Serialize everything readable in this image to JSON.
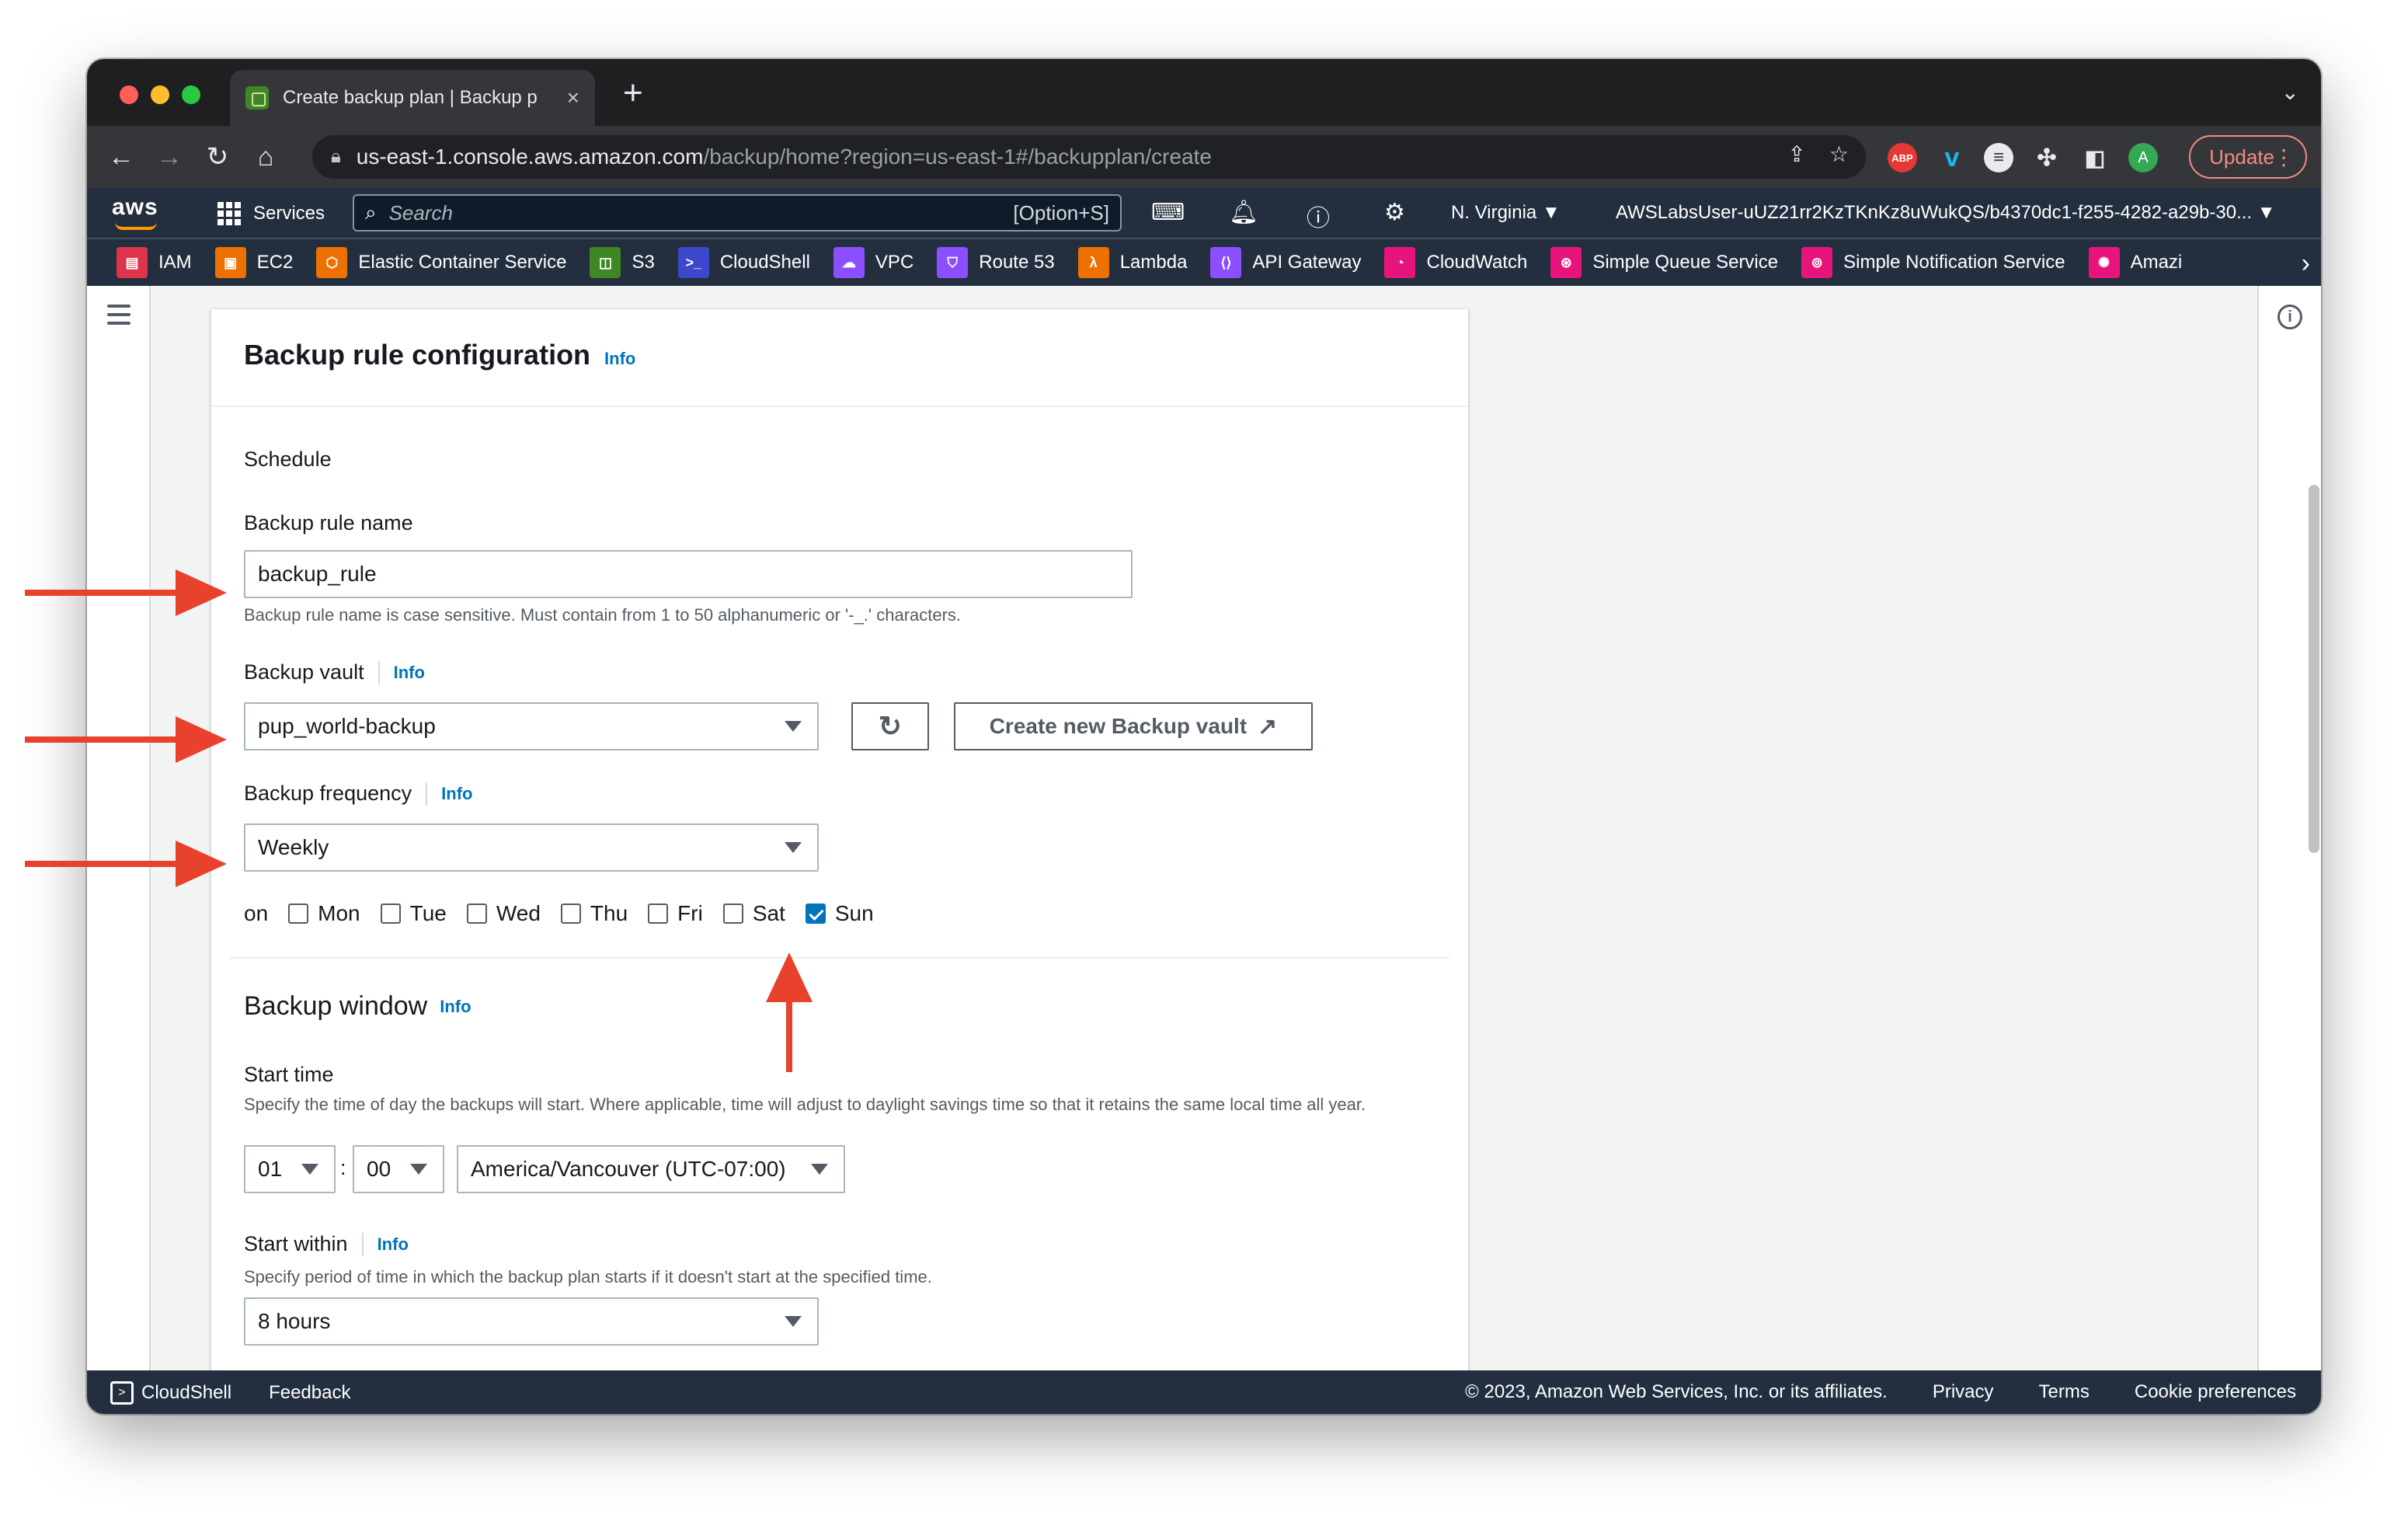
{
  "browser": {
    "tab_title": "Create backup plan | Backup p",
    "tab_close": "×",
    "new_tab": "+",
    "url_host": "us-east-1.console.aws.amazon.com",
    "url_path": "/backup/home?region=us-east-1#/backupplan/create",
    "update_label": "Update",
    "profile_initial": "A"
  },
  "awsnav": {
    "logo": "aws",
    "services_label": "Services",
    "search_placeholder": "Search",
    "search_shortcut": "[Option+S]",
    "region": "N. Virginia ▼",
    "account": "AWSLabsUser-uUZ21rr2KzTKnKz8uWukQS/b4370dc1-f255-4282-a29b-30... ▼"
  },
  "favorites": [
    {
      "label": "IAM",
      "color": "#dd344c"
    },
    {
      "label": "EC2",
      "color": "#ed7100"
    },
    {
      "label": "Elastic Container Service",
      "color": "#ed7100"
    },
    {
      "label": "S3",
      "color": "#3f8624"
    },
    {
      "label": "CloudShell",
      "color": "#3b48cc"
    },
    {
      "label": "VPC",
      "color": "#8c4fff"
    },
    {
      "label": "Route 53",
      "color": "#8c4fff"
    },
    {
      "label": "Lambda",
      "color": "#ed7100"
    },
    {
      "label": "API Gateway",
      "color": "#8c4fff"
    },
    {
      "label": "CloudWatch",
      "color": "#e7157b"
    },
    {
      "label": "Simple Queue Service",
      "color": "#e7157b"
    },
    {
      "label": "Simple Notification Service",
      "color": "#e7157b"
    },
    {
      "label": "Amazi",
      "color": "#e7157b"
    }
  ],
  "panel": {
    "title": "Backup rule configuration",
    "title_info": "Info",
    "schedule_heading": "Schedule",
    "rule_name_label": "Backup rule name",
    "rule_name_value": "backup_rule",
    "rule_name_hint": "Backup rule name is case sensitive. Must contain from 1 to 50 alphanumeric or '-_.' characters.",
    "vault_label": "Backup vault",
    "vault_info": "Info",
    "vault_value": "pup_world-backup",
    "create_vault_label": "Create new Backup vault",
    "frequency_label": "Backup frequency",
    "frequency_info": "Info",
    "frequency_value": "Weekly",
    "days_prefix": "on",
    "days": [
      {
        "label": "Mon",
        "checked": false
      },
      {
        "label": "Tue",
        "checked": false
      },
      {
        "label": "Wed",
        "checked": false
      },
      {
        "label": "Thu",
        "checked": false
      },
      {
        "label": "Fri",
        "checked": false
      },
      {
        "label": "Sat",
        "checked": false
      },
      {
        "label": "Sun",
        "checked": true
      }
    ],
    "window_heading": "Backup window",
    "window_info": "Info",
    "start_time_label": "Start time",
    "start_time_hint": "Specify the time of day the backups will start. Where applicable, time will adjust to daylight savings time so that it retains the same local time all year.",
    "hour_value": "01",
    "time_sep": ":",
    "minute_value": "00",
    "timezone_value": "America/Vancouver (UTC-07:00)",
    "start_within_label": "Start within",
    "start_within_info": "Info",
    "start_within_hint": "Specify period of time in which the backup plan starts if it doesn't start at the specified time.",
    "start_within_value": "8 hours"
  },
  "footer": {
    "cloudshell": "CloudShell",
    "feedback": "Feedback",
    "copyright": "© 2023, Amazon Web Services, Inc. or its affiliates.",
    "privacy": "Privacy",
    "terms": "Terms",
    "cookies": "Cookie preferences"
  },
  "annotation_color": "#e8412c"
}
